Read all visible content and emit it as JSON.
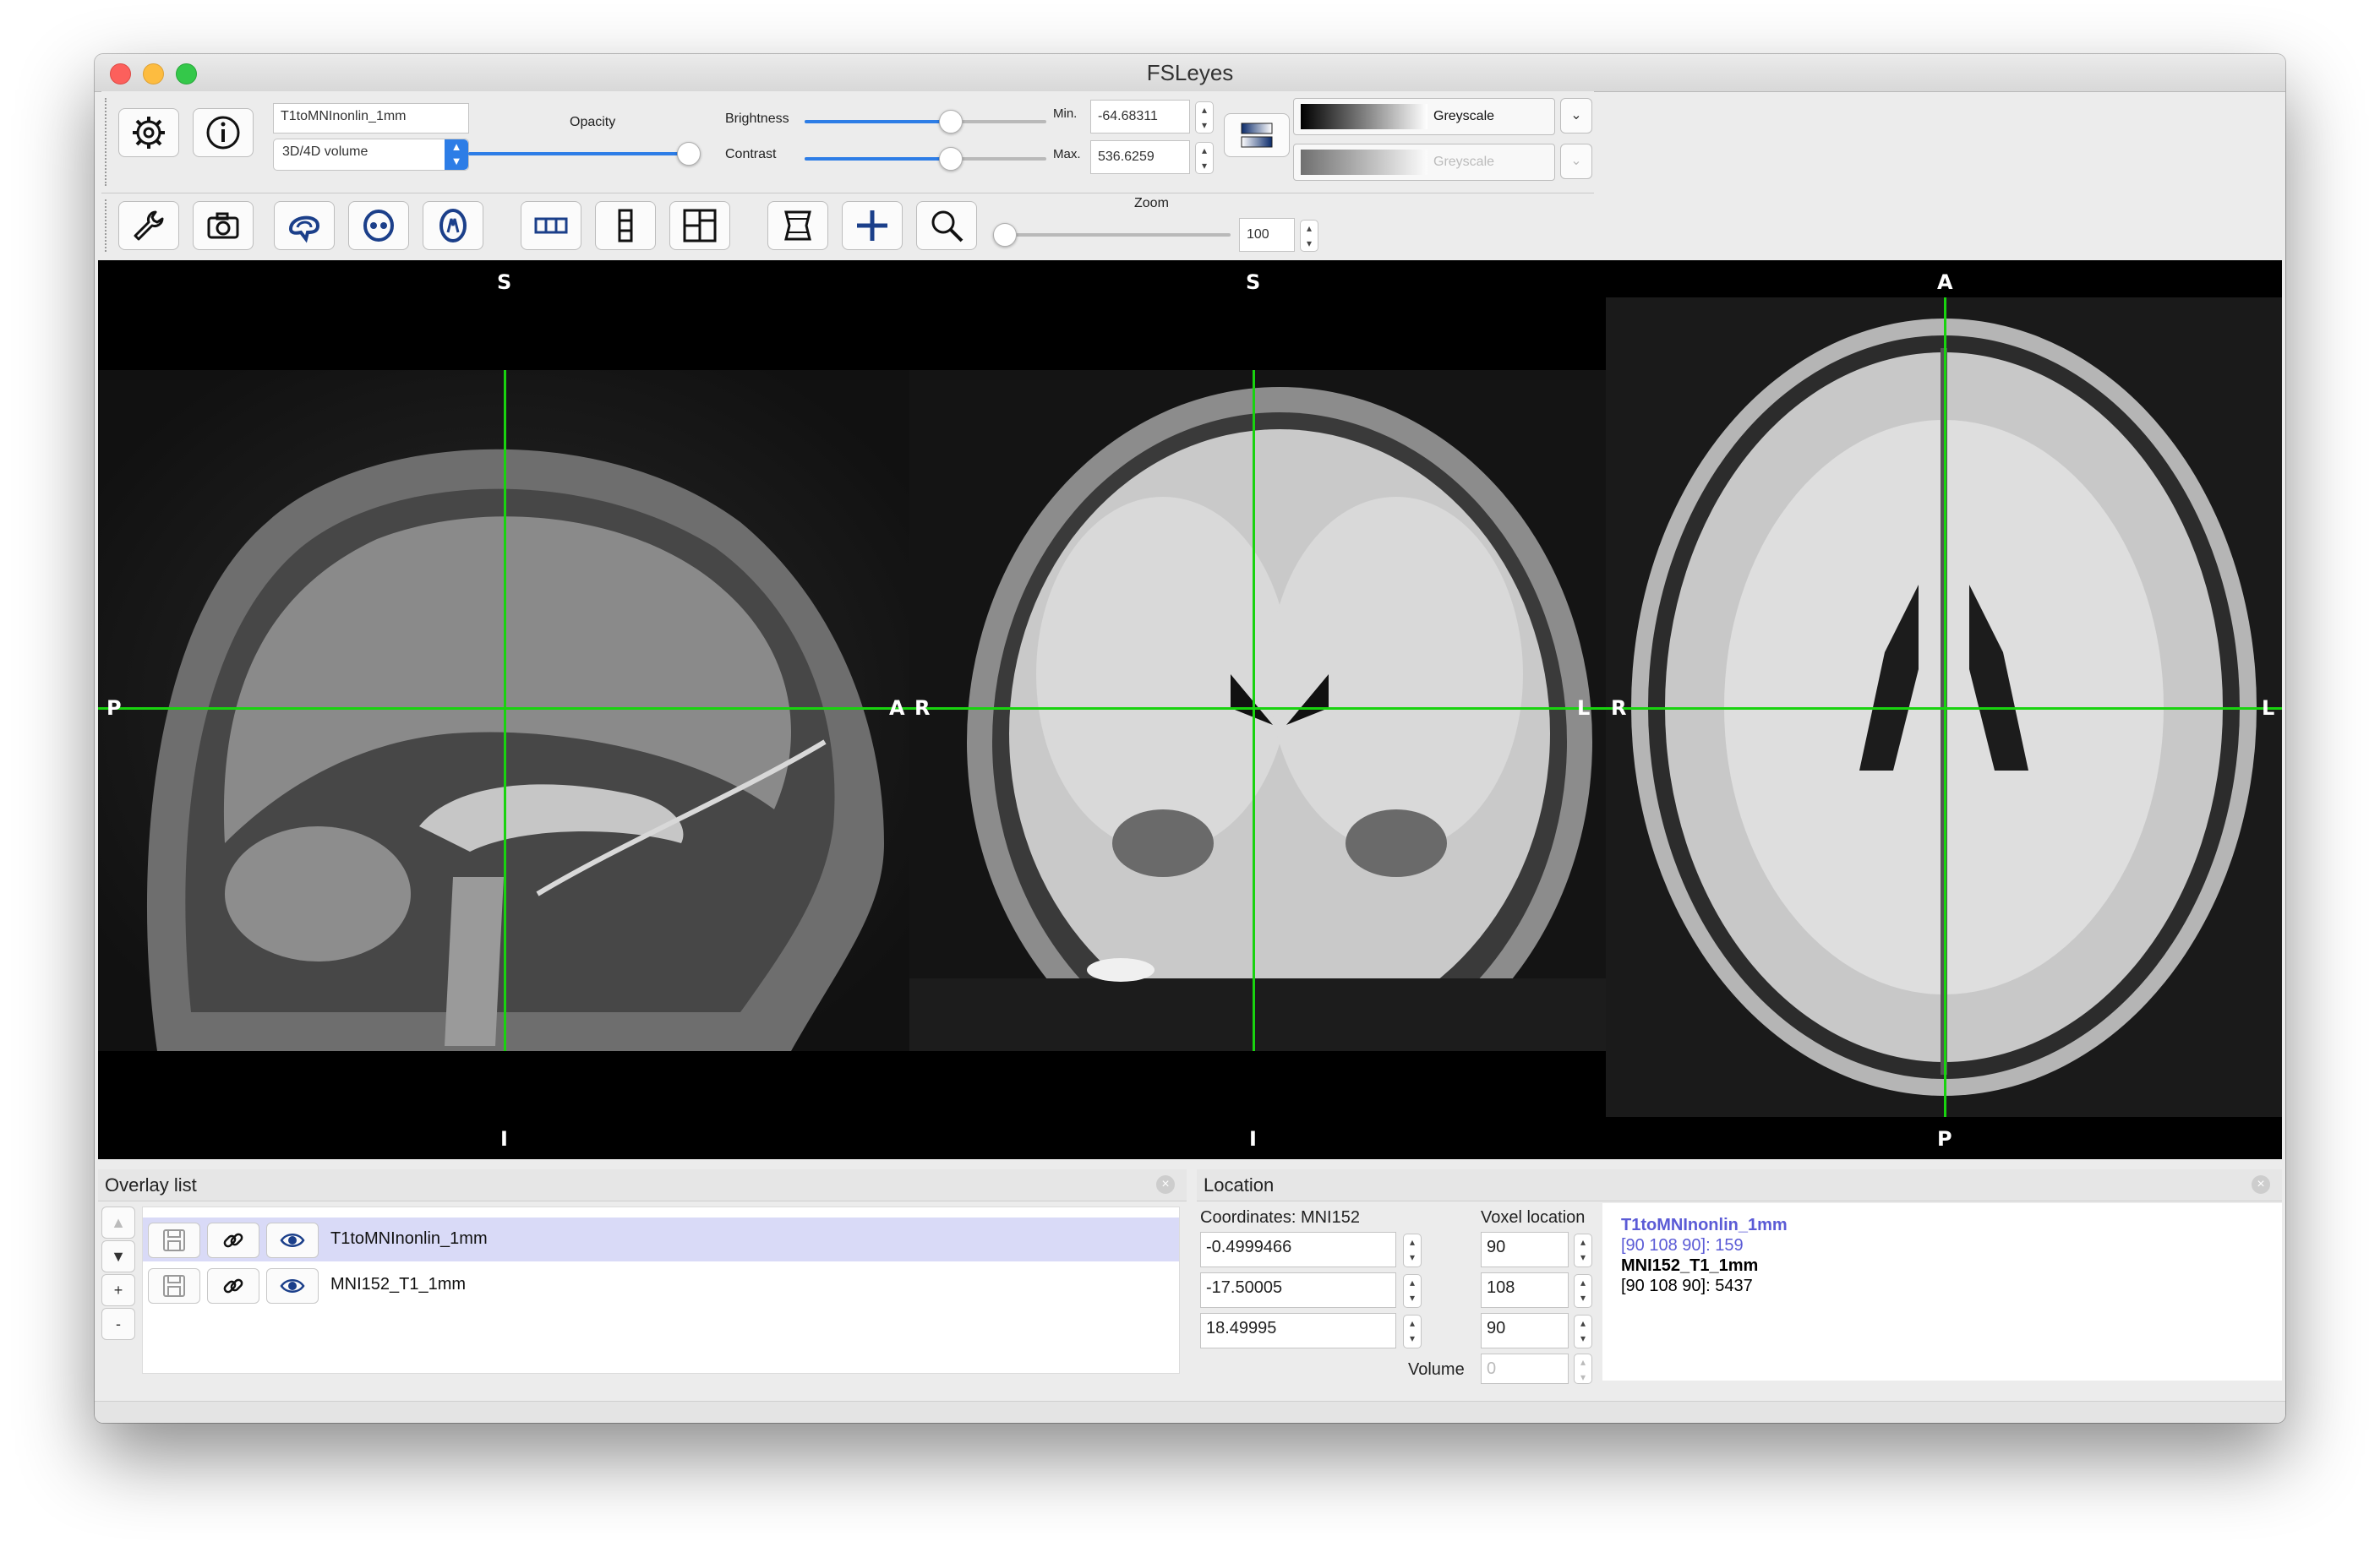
{
  "window": {
    "title": "FSLeyes"
  },
  "toolbar": {
    "overlay_name": "T1toMNInonlin_1mm",
    "overlay_type": "3D/4D volume",
    "opacity_label": "Opacity",
    "brightness_label": "Brightness",
    "contrast_label": "Contrast",
    "min_label": "Min.",
    "max_label": "Max.",
    "min_value": "-64.68311",
    "max_value": "536.6259",
    "cmap_name": "Greyscale",
    "neg_cmap_name": "Greyscale",
    "opacity_level": 1.0,
    "brightness_level": 0.6,
    "contrast_level": 0.6
  },
  "view_toolbar": {
    "zoom_label": "Zoom",
    "zoom_value": "100",
    "zoom_level": 0.0
  },
  "orientation": {
    "sagittal": {
      "top": "S",
      "bottom": "I",
      "left": "P",
      "right": "A"
    },
    "coronal": {
      "top": "S",
      "bottom": "I",
      "left": "R",
      "right": "L"
    },
    "axial": {
      "top": "A",
      "bottom": "P",
      "left": "R",
      "right": "L"
    }
  },
  "overlay_list": {
    "title": "Overlay list",
    "items": [
      {
        "name": "T1toMNInonlin_1mm",
        "selected": true
      },
      {
        "name": "MNI152_T1_1mm",
        "selected": false
      }
    ],
    "buttons": {
      "up": "▲",
      "down": "▼",
      "add": "+",
      "remove": "-"
    }
  },
  "location": {
    "title": "Location",
    "coords_label": "Coordinates: MNI152",
    "voxel_label": "Voxel location",
    "coords": [
      "-0.4999466",
      "-17.50005",
      "18.49995"
    ],
    "voxels": [
      "90",
      "108",
      "90"
    ],
    "volume_label": "Volume",
    "volume_value": "0",
    "info": [
      {
        "name": "T1toMNInonlin_1mm",
        "value": "[90 108 90]: 159",
        "color": "#5b5bd6"
      },
      {
        "name": "MNI152_T1_1mm",
        "value": "[90 108 90]: 5437",
        "color": "#000000"
      }
    ]
  },
  "colors": {
    "crosshair": "#19d30f",
    "accent": "#2d7de6",
    "selection": "#d9daf7"
  }
}
